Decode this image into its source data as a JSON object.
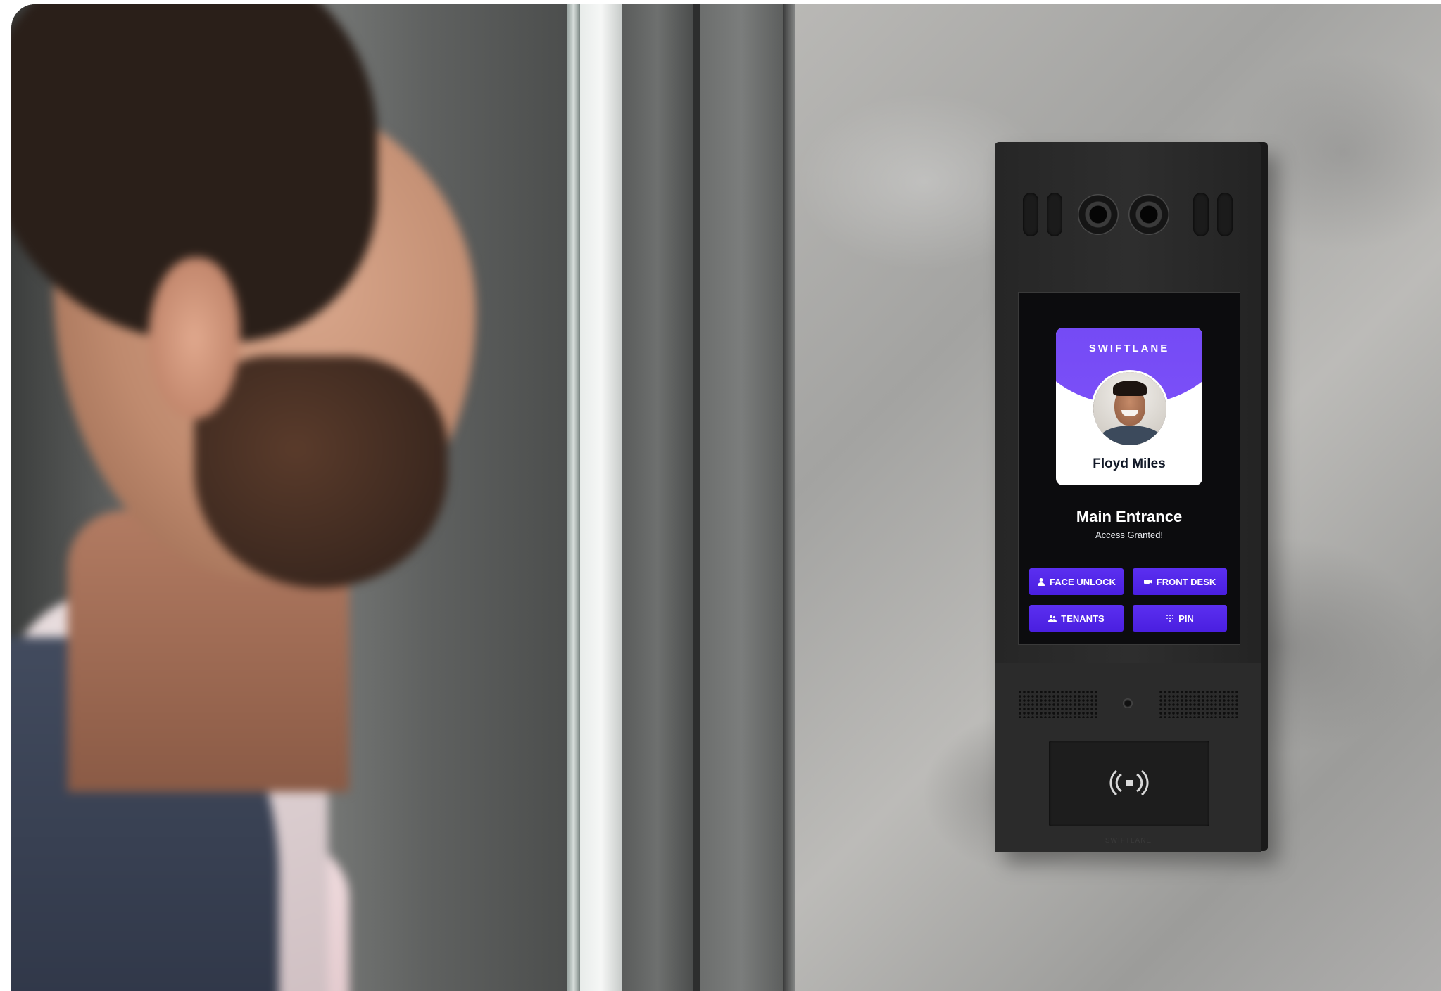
{
  "device": {
    "brand": "SWIFTLANE",
    "resident_name": "Floyd Miles",
    "location": "Main Entrance",
    "status": "Access Granted!",
    "buttons": [
      {
        "label": "FACE UNLOCK",
        "icon": "person-icon"
      },
      {
        "label": "FRONT DESK",
        "icon": "video-camera-icon"
      },
      {
        "label": "TENANTS",
        "icon": "people-icon"
      },
      {
        "label": "PIN",
        "icon": "keypad-icon"
      }
    ],
    "bottom_logo": "SWIFTLANE"
  },
  "colors": {
    "accent_purple": "#5b2ff0",
    "card_header_purple": "#7b4ff8",
    "device_body": "#2b2b2b",
    "screen_background": "#0c0c0e"
  }
}
